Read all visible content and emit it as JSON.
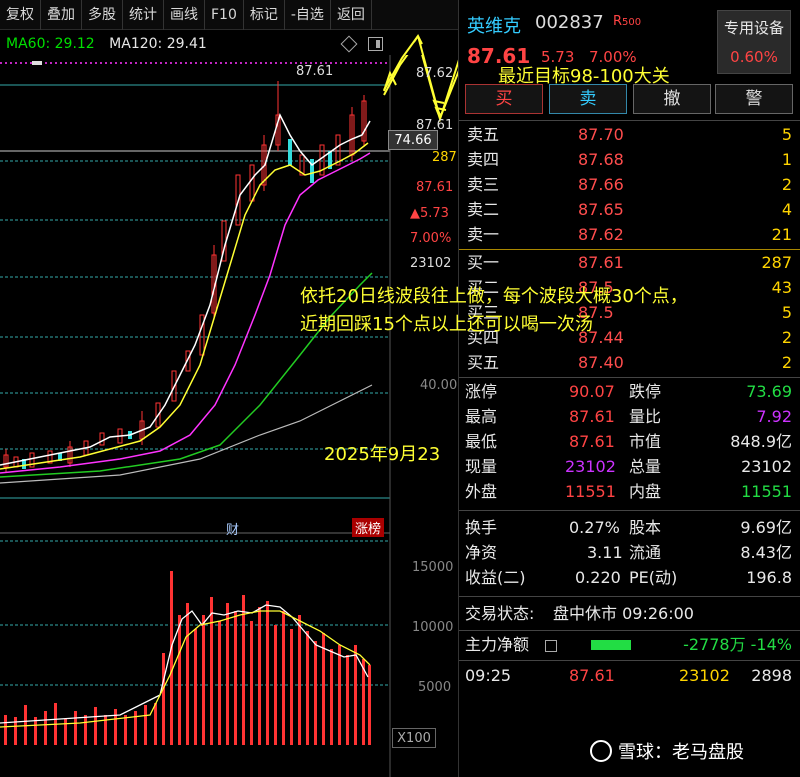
{
  "toolbar": [
    "复权",
    "叠加",
    "多股",
    "统计",
    "画线",
    "F10",
    "标记",
    "-自选",
    "返回"
  ],
  "ma": {
    "ma60": "MA60: 29.12",
    "ma120": "MA120: 29.41"
  },
  "chart": {
    "high_label": "87.61",
    "axis_prices": [
      "87.62",
      "87.61",
      "287",
      "87.61",
      "▲5.73",
      "7.00%",
      "23102",
      "40.00"
    ],
    "crosshair_price": "74.66",
    "cai_marker": "财",
    "zhangbang_marker": "涨榜",
    "volume_axis": [
      "15000",
      "10000",
      "5000"
    ],
    "volume_unit": "X100"
  },
  "annotations": {
    "target": "最近目标98-100大关",
    "strategy_line1": "依托20日线波段往上做，每个波段大概30个点，",
    "strategy_line2": "近期回踩15个点以上还可以喝一次汤",
    "date": "2025年9月23"
  },
  "quote": {
    "name": "英维克",
    "code": "002837",
    "badge": "R",
    "badge_num": "500",
    "price": "87.61",
    "change": "5.73",
    "pct": "7.00%",
    "device_label": "专用设备",
    "device_pct": "0.60%"
  },
  "trade_buttons": [
    "买",
    "卖",
    "撤",
    "警"
  ],
  "asks": [
    {
      "label": "卖五",
      "price": "87.70",
      "qty": "5"
    },
    {
      "label": "卖四",
      "price": "87.68",
      "qty": "1"
    },
    {
      "label": "卖三",
      "price": "87.66",
      "qty": "2"
    },
    {
      "label": "卖二",
      "price": "87.65",
      "qty": "4"
    },
    {
      "label": "卖一",
      "price": "87.62",
      "qty": "21"
    }
  ],
  "bids": [
    {
      "label": "买一",
      "price": "87.61",
      "qty": "287"
    },
    {
      "label": "买二",
      "price": "87.5",
      "qty": "43"
    },
    {
      "label": "买三",
      "price": "87.5",
      "qty": "5"
    },
    {
      "label": "买四",
      "price": "87.44",
      "qty": "2"
    },
    {
      "label": "买五",
      "price": "87.40",
      "qty": "2"
    }
  ],
  "stats": {
    "zhangting_l": "涨停",
    "zhangting_v": "90.07",
    "dieting_l": "跌停",
    "dieting_v": "73.69",
    "zuigao_l": "最高",
    "zuigao_v": "87.61",
    "liangbi_l": "量比",
    "liangbi_v": "7.92",
    "zuidi_l": "最低",
    "zuidi_v": "87.61",
    "shizhi_l": "市值",
    "shizhi_v": "848.9亿",
    "xianliang_l": "现量",
    "xianliang_v": "23102",
    "zongliang_l": "总量",
    "zongliang_v": "23102",
    "waipan_l": "外盘",
    "waipan_v": "11551",
    "neipan_l": "内盘",
    "neipan_v": "11551",
    "huanshou_l": "换手",
    "huanshou_v": "0.27%",
    "guben_l": "股本",
    "guben_v": "9.69亿",
    "jingzi_l": "净资",
    "jingzi_v": "3.11",
    "liutong_l": "流通",
    "liutong_v": "8.43亿",
    "shouyi_l": "收益(二)",
    "shouyi_v": "0.220",
    "pe_l": "PE(动)",
    "pe_v": "196.8"
  },
  "status": {
    "label": "交易状态:",
    "value": "盘中休市 09:26:00"
  },
  "mainflow": {
    "label": "主力净额",
    "value": "-2778万 -14%"
  },
  "tick": {
    "time": "09:25",
    "price": "87.61",
    "vol": "23102",
    "extra": "2898"
  },
  "watermark": "雪球：老马盘股",
  "colors": {
    "up": "#ff4444",
    "down": "#22dd44",
    "ma_yellow": "#ffff33",
    "ma_magenta": "#ff33ff",
    "ma_green": "#22cc22",
    "ma_white": "#cccccc"
  }
}
